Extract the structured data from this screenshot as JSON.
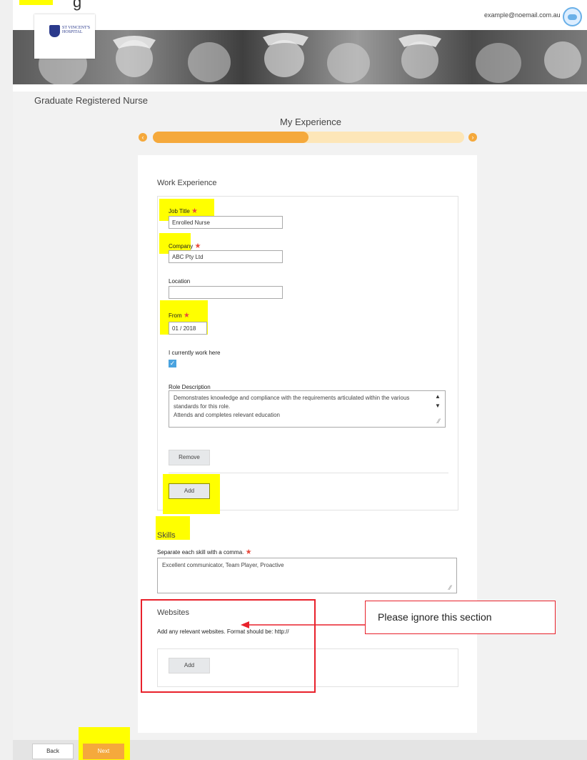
{
  "header": {
    "top_label": "g",
    "logo_text": "ST VINCENT'S HOSPITAL",
    "user_email": "example@noemail.com.au",
    "banner_name": "nurses-photo"
  },
  "page_title": "Graduate Registered Nurse",
  "wizard": {
    "step_title": "My Experience",
    "progress_percent": 50,
    "prev_icon": "chevron-left",
    "next_icon": "chevron-right"
  },
  "work_experience": {
    "title": "Work Experience",
    "job_title": {
      "label": "Job Title",
      "value": "Enrolled Nurse"
    },
    "company": {
      "label": "Company",
      "value": "ABC Pty Ltd"
    },
    "location": {
      "label": "Location",
      "value": ""
    },
    "from": {
      "label": "From",
      "value": "01 / 2018"
    },
    "current": {
      "label": "I currently work here",
      "checked": true
    },
    "role_description": {
      "label": "Role Description",
      "value": "Demonstrates knowledge and compliance with the requirements articulated within the various standards for this role.\nAttends and completes relevant education"
    },
    "remove_label": "Remove",
    "add_label": "Add"
  },
  "skills": {
    "title": "Skills",
    "label": "Separate each skill with a comma.",
    "value": "Excellent communicator, Team Player, Proactive"
  },
  "websites": {
    "title": "Websites",
    "hint": "Add any relevant websites. Format should be: http://",
    "add_label": "Add"
  },
  "annotation": {
    "note": "Please ignore this section",
    "color": "#e8212b"
  },
  "footer": {
    "back_label": "Back",
    "next_label": "Next"
  },
  "colors": {
    "accent": "#f5a93c",
    "highlight": "#ffff00",
    "required": "#e84a3c",
    "checkbox": "#4aa3df"
  }
}
